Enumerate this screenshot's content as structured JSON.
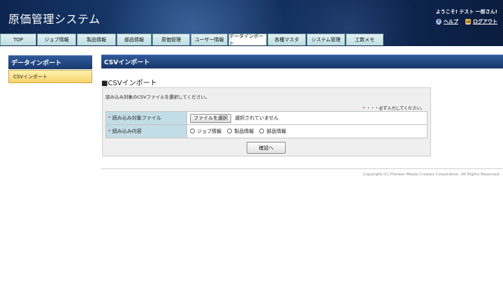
{
  "header": {
    "app_title": "原価管理システム",
    "welcome": "ようこそ! テスト 一郎さん!",
    "help_label": "ヘルプ",
    "logout_label": "ログアウト"
  },
  "tabs": [
    {
      "label": "TOP"
    },
    {
      "label": "ジョブ情報"
    },
    {
      "label": "製品情報"
    },
    {
      "label": "部品情報"
    },
    {
      "label": "原価管理"
    },
    {
      "label": "ユーザー情報"
    },
    {
      "label": "データインポート",
      "active": true
    },
    {
      "label": "各種マスタ"
    },
    {
      "label": "システム管理"
    },
    {
      "label": "工数メモ"
    }
  ],
  "sidebar": {
    "title": "データインポート",
    "items": [
      {
        "label": "CSVインポート",
        "active": true
      }
    ]
  },
  "main": {
    "title_bar": "CSVインポート",
    "section_heading": "■CSVインポート",
    "instruction": "読み込み対象のCSVファイルを選択してください。",
    "required_mark": "*",
    "required_note": "・・・必ず入力してください。",
    "form": {
      "file_label": "読み込み対象ファイル",
      "file_button": "ファイルを選択",
      "file_status": "選択されていません",
      "content_label": "読み込み内容",
      "options": [
        {
          "label": "ジョブ情報",
          "selected": false
        },
        {
          "label": "製品情報",
          "selected": false
        },
        {
          "label": "部品情報",
          "selected": false
        }
      ]
    },
    "confirm_button": "確認へ"
  },
  "footer": {
    "copyright": "Copyright (C) Pioneer Media Creates Corporation. All Rights Reserved."
  },
  "colors": {
    "header_bg": "#0d2650",
    "tab_bg": "#b9dde1",
    "sidebar_active": "#f7d36a",
    "label_cell_bg": "#c3dde6",
    "required_mark": "#d0202a"
  }
}
